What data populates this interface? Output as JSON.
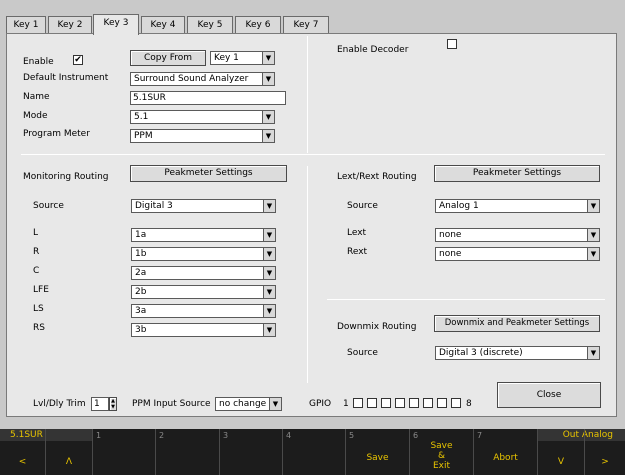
{
  "tabs": [
    "Key 1",
    "Key 2",
    "Key 3",
    "Key 4",
    "Key 5",
    "Key 6",
    "Key 7"
  ],
  "general": {
    "enable_label": "Enable",
    "enable_checked": "✔",
    "copy_from_label": "Copy From",
    "copy_from_value": "Key 1",
    "default_instrument_label": "Default Instrument",
    "default_instrument_value": "Surround Sound Analyzer",
    "name_label": "Name",
    "name_value": "5.1SUR",
    "mode_label": "Mode",
    "mode_value": "5.1",
    "program_meter_label": "Program Meter",
    "program_meter_value": "PPM",
    "enable_decoder_label": "Enable Decoder"
  },
  "monitoring": {
    "title": "Monitoring Routing",
    "peak_button": "Peakmeter Settings",
    "source_label": "Source",
    "source_value": "Digital 3",
    "channels": [
      {
        "label": "L",
        "value": "1a"
      },
      {
        "label": "R",
        "value": "1b"
      },
      {
        "label": "C",
        "value": "2a"
      },
      {
        "label": "LFE",
        "value": "2b"
      },
      {
        "label": "LS",
        "value": "3a"
      },
      {
        "label": "RS",
        "value": "3b"
      }
    ]
  },
  "lext": {
    "title": "Lext/Rext Routing",
    "peak_button": "Peakmeter Settings",
    "source_label": "Source",
    "source_value": "Analog 1",
    "lext_label": "Lext",
    "lext_value": "none",
    "rext_label": "Rext",
    "rext_value": "none"
  },
  "downmix": {
    "title": "Downmix Routing",
    "button": "Downmix and Peakmeter Settings",
    "source_label": "Source",
    "source_value": "Digital 3 (discrete)"
  },
  "footer": {
    "trim_label": "Lvl/Dly Trim",
    "trim_value": "1",
    "ppm_label": "PPM Input Source",
    "ppm_value": "no change",
    "gpio_label": "GPIO",
    "gpio_start": "1",
    "gpio_end": "8",
    "close_label": "Close"
  },
  "softkeys": {
    "left_title": "5.1SUR",
    "right_title": "Out Analog",
    "keys": [
      {
        "num": "",
        "label": "<"
      },
      {
        "num": "",
        "label": "Λ"
      },
      {
        "num": "1",
        "label": ""
      },
      {
        "num": "2",
        "label": ""
      },
      {
        "num": "3",
        "label": ""
      },
      {
        "num": "4",
        "label": ""
      },
      {
        "num": "5",
        "label": "Save"
      },
      {
        "num": "6",
        "label": "Save\n&\nExit"
      },
      {
        "num": "7",
        "label": "Abort"
      },
      {
        "num": "",
        "label": "V"
      },
      {
        "num": "",
        "label": ">"
      }
    ]
  },
  "colors": {
    "softkey_text": "#e8c400",
    "panel_bg": "#e8e8e8",
    "bottom_bg": "#1c1c1c"
  }
}
